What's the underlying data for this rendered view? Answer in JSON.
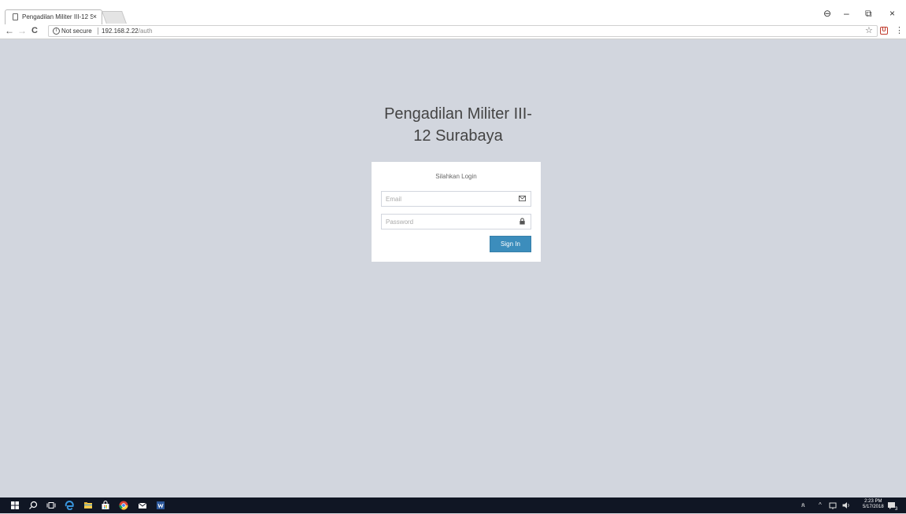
{
  "browser": {
    "tab_title": "Pengadilan Militer III-12 S",
    "tab_close": "×",
    "security_label": "Not secure",
    "url_host": "192.168.2.22",
    "url_path": "/auth",
    "back": "←",
    "forward": "→",
    "reload": "C",
    "star": "☆",
    "menu": "⋮",
    "account": "⊖",
    "minimize": "–",
    "restore": "⧉",
    "close": "×",
    "extension_badge": "U"
  },
  "page": {
    "title_line1": "Pengadilan Militer III-",
    "title_line2": "12 Surabaya",
    "login_message": "Silahkan Login",
    "email_placeholder": "Email",
    "password_placeholder": "Password",
    "signin_label": "Sign In"
  },
  "taskbar": {
    "time": "2:23 PM",
    "date": "5/17/2018",
    "notification_count": "3",
    "apps": [
      "start-icon",
      "search-icon",
      "task-view-icon",
      "edge-icon",
      "file-explorer-icon",
      "store-icon",
      "chrome-icon",
      "mail-icon",
      "word-icon"
    ]
  },
  "colors": {
    "background": "#d2d6de",
    "primary_button": "#3c8dbc",
    "taskbar": "#101624"
  }
}
